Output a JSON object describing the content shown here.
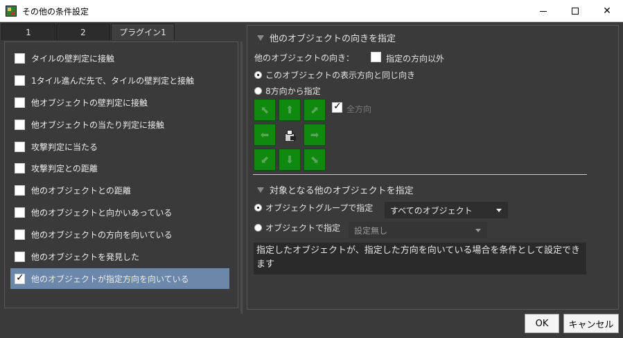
{
  "window": {
    "title": "その他の条件設定",
    "controls": {
      "minimize": "minimize-icon",
      "maximize": "maximize-icon",
      "close": "close-icon"
    }
  },
  "tabs": [
    {
      "label": "1",
      "active": false
    },
    {
      "label": "2",
      "active": false
    },
    {
      "label": "プラグイン1",
      "active": true
    }
  ],
  "conditions": [
    {
      "label": "タイルの壁判定に接触",
      "checked": false,
      "selected": false
    },
    {
      "label": "1タイル進んだ先で、タイルの壁判定と接触",
      "checked": false,
      "selected": false
    },
    {
      "label": "他オブジェクトの壁判定に接触",
      "checked": false,
      "selected": false
    },
    {
      "label": "他オブジェクトの当たり判定に接触",
      "checked": false,
      "selected": false
    },
    {
      "label": "攻撃判定に当たる",
      "checked": false,
      "selected": false
    },
    {
      "label": "攻撃判定との距離",
      "checked": false,
      "selected": false
    },
    {
      "label": "他のオブジェクトとの距離",
      "checked": false,
      "selected": false
    },
    {
      "label": "他のオブジェクトと向かいあっている",
      "checked": false,
      "selected": false
    },
    {
      "label": "他のオブジェクトの方向を向いている",
      "checked": false,
      "selected": false
    },
    {
      "label": "他のオブジェクトを発見した",
      "checked": false,
      "selected": false
    },
    {
      "label": "他のオブジェクトが指定方向を向いている",
      "checked": true,
      "selected": true
    }
  ],
  "direction_section": {
    "title": "他のオブジェクトの向きを指定",
    "direction_label": "他のオブジェクトの向き：",
    "except_label": "指定の方向以外",
    "except_checked": false,
    "option_same": "このオブジェクトの表示方向と同じ向き",
    "option_same_selected": true,
    "option_eight": "8方向から指定",
    "option_eight_selected": false,
    "all_directions_label": "全方向",
    "all_directions_checked": true,
    "direction_buttons": {
      "up_left": "arrow-up-left-icon",
      "up": "arrow-up-icon",
      "up_right": "arrow-up-right-icon",
      "left": "arrow-left-icon",
      "right": "arrow-right-icon",
      "down_left": "arrow-down-left-icon",
      "down": "arrow-down-icon",
      "down_right": "arrow-down-right-icon"
    },
    "center_icon": "camera-actor-icon"
  },
  "target_section": {
    "title": "対象となる他のオブジェクトを指定",
    "group_label": "オブジェクトグループで指定",
    "group_selected": true,
    "group_value": "すべてのオブジェクト",
    "object_label": "オブジェクトで指定",
    "object_selected": false,
    "object_value": "設定無し"
  },
  "description": "指定したオブジェクトが、指定した方向を向いている場合を条件として設定できます",
  "buttons": {
    "ok": "OK",
    "cancel": "キャンセル"
  },
  "colors": {
    "background": "#3a3a3a",
    "selection": "#6b87aa",
    "direction_green": "#0f8a0f"
  }
}
